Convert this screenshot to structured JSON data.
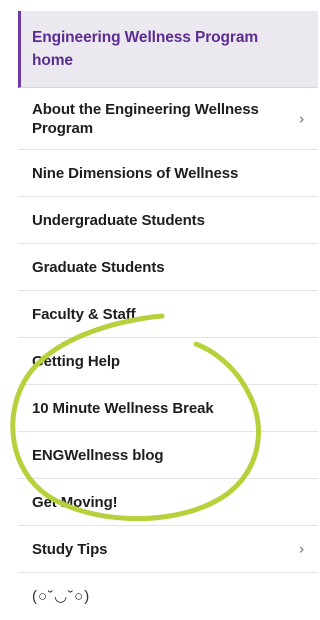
{
  "nav": {
    "items": [
      {
        "label": "Engineering Wellness Program home",
        "has_submenu": false
      },
      {
        "label": "About the Engineering Wellness Program",
        "has_submenu": true
      },
      {
        "label": "Nine Dimensions of Wellness",
        "has_submenu": false
      },
      {
        "label": "Undergraduate Students",
        "has_submenu": false
      },
      {
        "label": "Graduate Students",
        "has_submenu": false
      },
      {
        "label": "Faculty & Staff",
        "has_submenu": false
      },
      {
        "label": "Getting Help",
        "has_submenu": false
      },
      {
        "label": "10 Minute Wellness Break",
        "has_submenu": false
      },
      {
        "label": "ENGWellness blog",
        "has_submenu": false
      },
      {
        "label": "Get Moving!",
        "has_submenu": false
      },
      {
        "label": "Study Tips",
        "has_submenu": true
      }
    ],
    "chevron": "›",
    "footer_emoticon": "(○˘◡˘○)"
  },
  "colors": {
    "active_text": "#5c2d91",
    "active_bg": "#ebe8f0",
    "highlight_stroke": "#b5d23c"
  }
}
